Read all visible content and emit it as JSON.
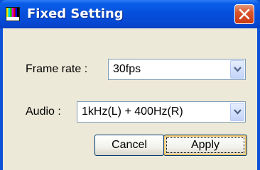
{
  "window": {
    "title": "Fixed Setting",
    "icon": "video-test-pattern-icon",
    "close_icon": "close-icon"
  },
  "frame_rate": {
    "label": "Frame rate :",
    "value": "30fps"
  },
  "audio": {
    "label": "Audio :",
    "value": "1kHz(L) + 400Hz(R)"
  },
  "buttons": {
    "cancel": "Cancel",
    "apply": "Apply"
  },
  "colors": {
    "titlebar": "#0650dd",
    "client": "#ece9d8",
    "close": "#d9542a"
  }
}
